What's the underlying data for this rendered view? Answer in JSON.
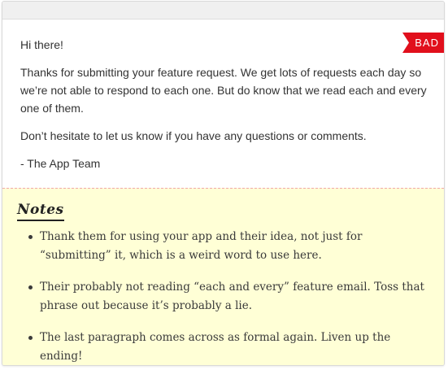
{
  "badge": "BAD",
  "email": {
    "greeting": "Hi there!",
    "body1": "Thanks for submitting your feature request. We get lots of requests each day so we’re not able to respond to each one. But do know that we read each and every one of them.",
    "body2": "Don’t hesitate to let us know if you have any questions or comments.",
    "signature": "- The App Team"
  },
  "notes": {
    "title": "Notes",
    "items": [
      "Thank them for using your app and their idea, not just for “submitting” it, which is a weird word to use here.",
      "Their probably not reading “each and every” feature email. Toss that phrase out because it’s probably a lie.",
      "The last paragraph comes across as formal again. Liven up the ending!"
    ]
  },
  "colors": {
    "badge": "#e10f1c",
    "notes_bg": "#ffffd6",
    "divider": "#f1a7a7"
  }
}
